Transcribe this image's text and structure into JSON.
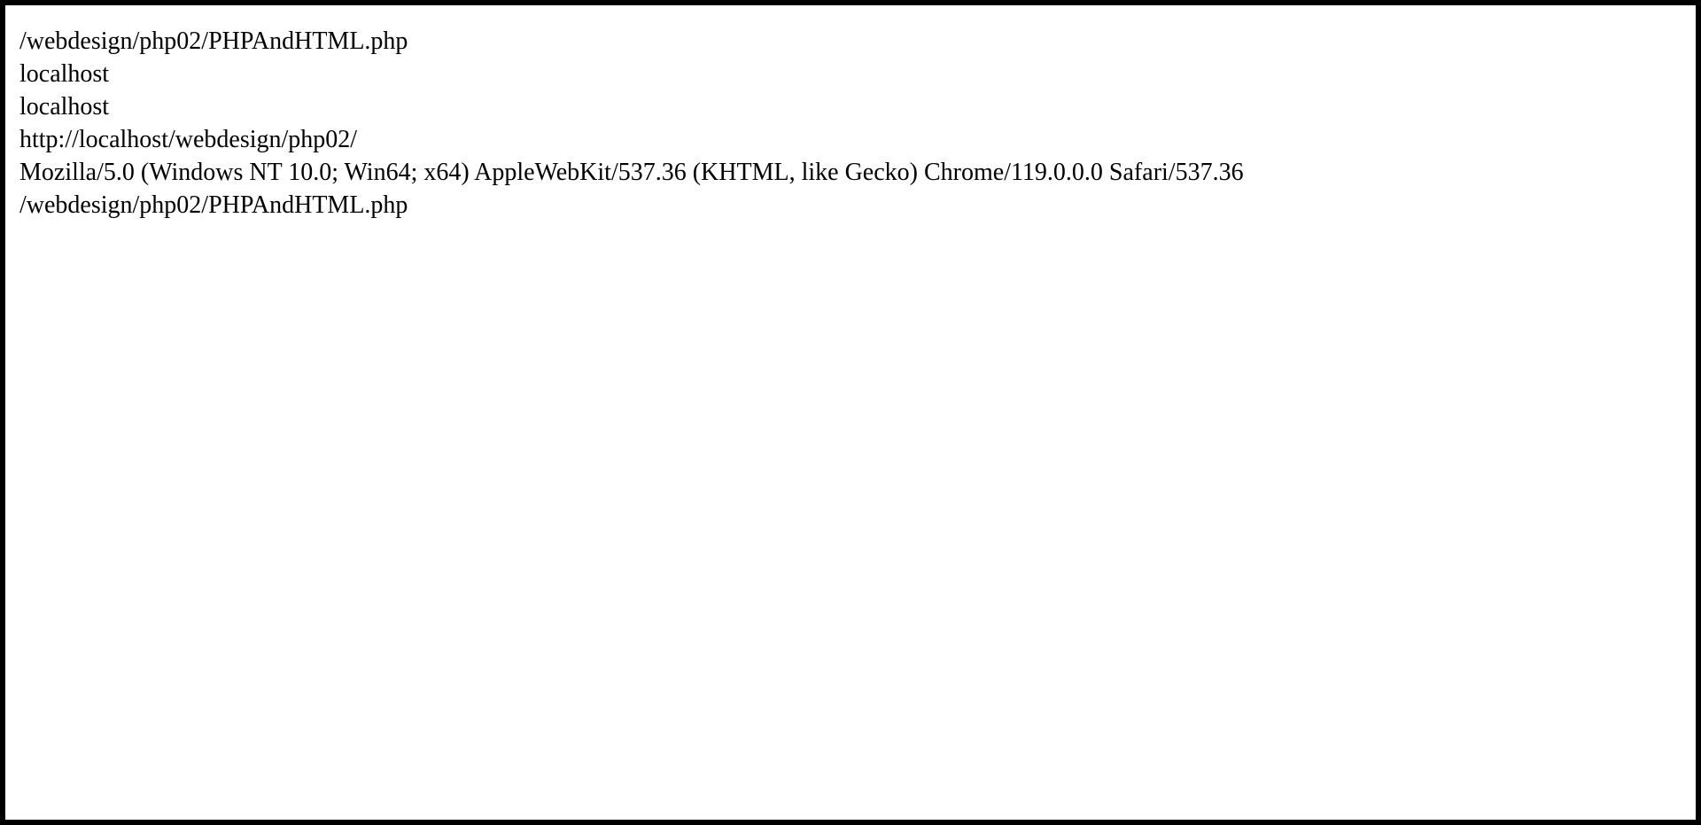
{
  "lines": [
    "/webdesign/php02/PHPAndHTML.php",
    "localhost",
    "localhost",
    "http://localhost/webdesign/php02/",
    "Mozilla/5.0 (Windows NT 10.0; Win64; x64) AppleWebKit/537.36 (KHTML, like Gecko) Chrome/119.0.0.0 Safari/537.36",
    "/webdesign/php02/PHPAndHTML.php"
  ],
  "colors": {
    "frame": "#000000",
    "background": "#ffffff",
    "text": "#000000"
  }
}
